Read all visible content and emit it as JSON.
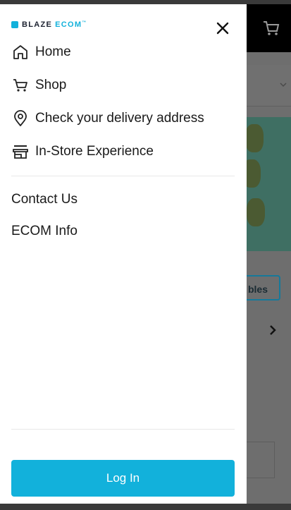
{
  "brand": {
    "name_part1": "BLAZE",
    "name_part2": "ECOM",
    "trademark": "™",
    "accent_color": "#12b1db"
  },
  "nav": {
    "items": [
      {
        "label": "Home",
        "icon": "home-icon"
      },
      {
        "label": "Shop",
        "icon": "cart-icon"
      },
      {
        "label": "Check your delivery address",
        "icon": "location-pin-icon"
      },
      {
        "label": "In-Store Experience",
        "icon": "store-icon"
      }
    ]
  },
  "links": [
    {
      "label": "Contact Us"
    },
    {
      "label": "ECOM Info"
    }
  ],
  "actions": {
    "login_label": "Log In"
  },
  "background": {
    "pill_label": "bles"
  }
}
